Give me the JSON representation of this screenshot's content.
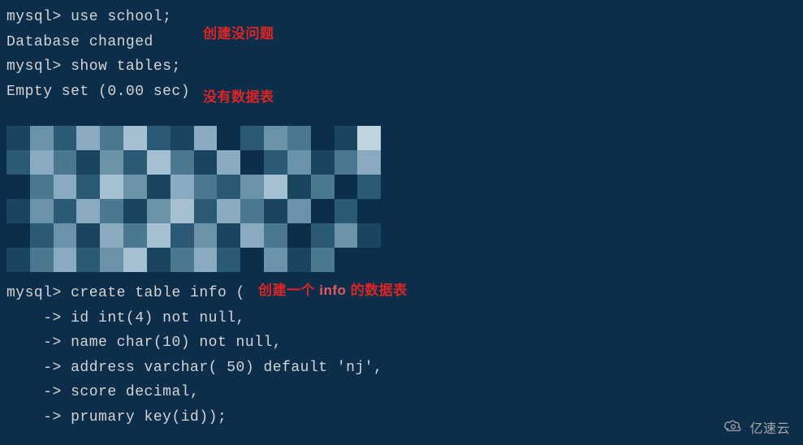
{
  "terminal": {
    "prompt": "mysql> ",
    "cont": "    -> ",
    "lines": [
      "use school;",
      "Database changed",
      "show tables;",
      "Empty set (0.00 sec)",
      "",
      "create table info (",
      "id int(4) not null,",
      "name char(10) not null,",
      "address varchar( 50) default 'nj',",
      "score decimal,",
      "prumary key(id));"
    ]
  },
  "annotations": {
    "a1": "创建没问题",
    "a2": "没有数据表",
    "a3_prefix": "创建一个 ",
    "a3_mid": "info",
    "a3_suffix": " 的数据表"
  },
  "watermark": {
    "text": "亿速云"
  },
  "colors": {
    "blur_palette": [
      "#0c2e4a",
      "#1a4560",
      "#2a5a76",
      "#4a7890",
      "#6a92a8",
      "#8aabbf",
      "#a5c0d0",
      "#c0d5e0"
    ]
  }
}
